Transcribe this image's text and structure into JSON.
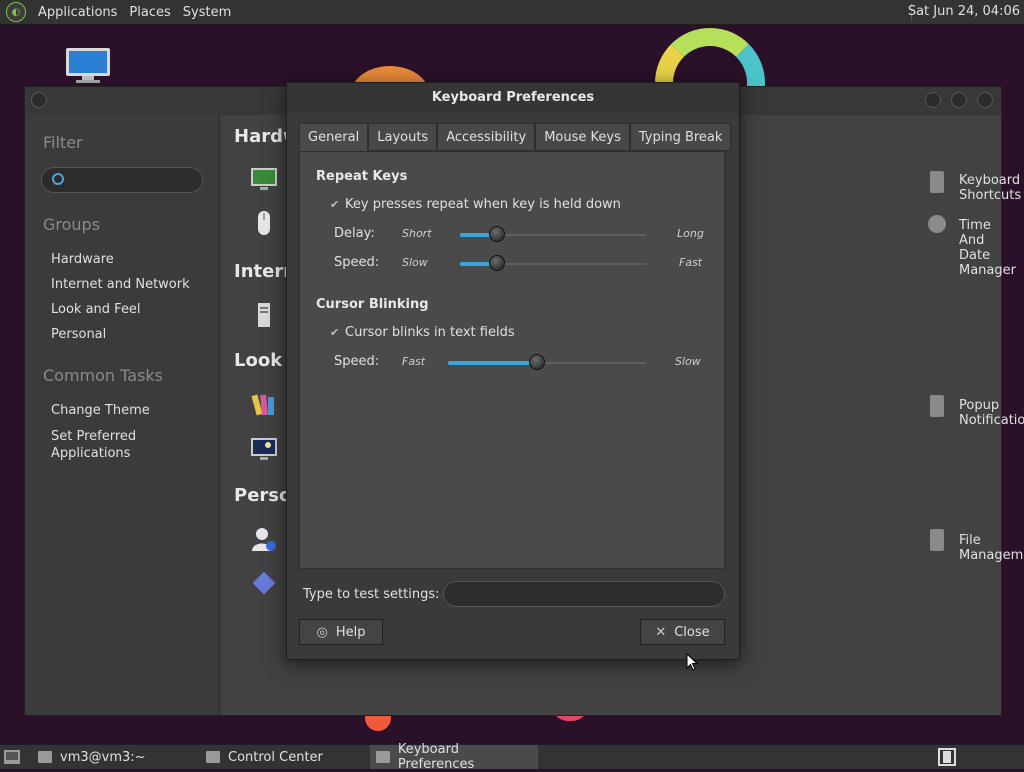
{
  "top_panel": {
    "menus": [
      "Applications",
      "Places",
      "System"
    ],
    "clock": "Sat Jun 24, 04:06"
  },
  "control_center": {
    "sidebar": {
      "filter_heading": "Filter",
      "groups_heading": "Groups",
      "groups": [
        "Hardware",
        "Internet and Network",
        "Look and Feel",
        "Personal"
      ],
      "tasks_heading": "Common Tasks",
      "tasks": [
        "Change Theme",
        "Set Preferred\nApplications"
      ]
    },
    "sections": [
      "Hardw",
      "Intern",
      "Look a",
      "Perso"
    ],
    "right_items": [
      "Keyboard Shortcuts",
      "Time And Date Manager",
      "Popup Notifications",
      "File Management"
    ]
  },
  "dialog": {
    "title": "Keyboard Preferences",
    "tabs": [
      "General",
      "Layouts",
      "Accessibility",
      "Mouse Keys",
      "Typing Break"
    ],
    "repeat": {
      "heading": "Repeat Keys",
      "checkbox_label": "Key presses repeat when key is held down",
      "checked": true,
      "delay_label": "Delay:",
      "delay_min": "Short",
      "delay_max": "Long",
      "delay_value": 0.2,
      "speed_label": "Speed:",
      "speed_min": "Slow",
      "speed_max": "Fast",
      "speed_value": 0.2
    },
    "cursor": {
      "heading": "Cursor Blinking",
      "checkbox_label": "Cursor blinks in text fields",
      "checked": true,
      "speed_label": "Speed:",
      "speed_min": "Fast",
      "speed_max": "Slow",
      "speed_value": 0.45
    },
    "test_label": "Type to test settings:",
    "test_value": "",
    "help_label": "Help",
    "close_label": "Close"
  },
  "taskbar": {
    "tasks": [
      "vm3@vm3:~",
      "Control Center",
      "Keyboard Preferences"
    ]
  }
}
